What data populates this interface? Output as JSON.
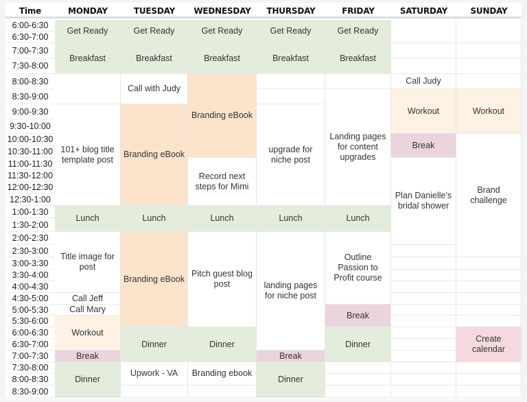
{
  "colors": {
    "green": "#e4ecdc",
    "orange": "#fbe3cc",
    "cream": "#fdf2e4",
    "mauve": "#ead4de",
    "pink": "#f6d9de",
    "white": "#ffffff"
  },
  "header": {
    "time": "Time",
    "days": [
      "MONDAY",
      "TUESDAY",
      "WEDNESDAY",
      "THURSDAY",
      "FRIDAY",
      "SATURDAY",
      "SUNDAY"
    ]
  },
  "time_slots": [
    "6:00-6:30",
    "6:30-7:00",
    "7:00-7:30",
    "7:30-8:00",
    "8:00-8:30",
    "8:30-9:00",
    "9:00-9:30",
    "9:30-10:00",
    "10:00-10:30",
    "10:30-11:00",
    "11:00-11:30",
    "11:30-12:00",
    "12:00-12:30",
    "12:30-1:00",
    "1:00-1:30",
    "1:30-2:00",
    "2:00-2:30",
    "2:30-3:00",
    "3:00-3:30",
    "3:30-4:00",
    "4:00-4:30",
    "4:30-5:00",
    "5:00-5:30",
    "5:30-6:00",
    "6:00-6:30",
    "6:30-7:00",
    "7:00-7:30",
    "7:30-8:00",
    "8:00-8:30",
    "8:30-9:00"
  ],
  "schedule": {
    "monday": [
      {
        "start": "6:00",
        "end": "7:00",
        "label": "Get Ready",
        "color": "green"
      },
      {
        "start": "7:00",
        "end": "8:00",
        "label": "Breakfast",
        "color": "green"
      },
      {
        "start": "8:00",
        "end": "9:00",
        "label": "",
        "color": "white"
      },
      {
        "start": "9:00",
        "end": "1:00",
        "label": "101+ blog title template post",
        "color": "white"
      },
      {
        "start": "1:00",
        "end": "2:00",
        "label": "Lunch",
        "color": "green"
      },
      {
        "start": "2:00",
        "end": "4:30",
        "label": "Title image for post",
        "color": "white"
      },
      {
        "start": "4:30",
        "end": "5:00",
        "label": "Call Jeff",
        "color": "white"
      },
      {
        "start": "5:00",
        "end": "5:30",
        "label": "Call Mary",
        "color": "white"
      },
      {
        "start": "5:30",
        "end": "7:00",
        "label": "Workout",
        "color": "cream"
      },
      {
        "start": "7:00",
        "end": "7:30",
        "label": "Break",
        "color": "mauve"
      },
      {
        "start": "7:30",
        "end": "9:00",
        "label": "Dinner",
        "color": "green"
      }
    ],
    "tuesday": [
      {
        "start": "6:00",
        "end": "7:00",
        "label": "Get Ready",
        "color": "green"
      },
      {
        "start": "7:00",
        "end": "8:00",
        "label": "Breakfast",
        "color": "green"
      },
      {
        "start": "8:00",
        "end": "9:00",
        "label": "Call with Judy",
        "color": "white"
      },
      {
        "start": "9:00",
        "end": "1:00",
        "label": "Branding eBook",
        "color": "orange"
      },
      {
        "start": "1:00",
        "end": "2:00",
        "label": "Lunch",
        "color": "green"
      },
      {
        "start": "2:00",
        "end": "6:00",
        "label": "Branding eBook",
        "color": "orange"
      },
      {
        "start": "6:00",
        "end": "7:30",
        "label": "Dinner",
        "color": "green"
      },
      {
        "start": "7:30",
        "end": "8:30",
        "label": "Upwork - VA",
        "color": "white"
      },
      {
        "start": "8:30",
        "end": "9:00",
        "label": "",
        "color": "white"
      }
    ],
    "wednesday": [
      {
        "start": "6:00",
        "end": "7:00",
        "label": "Get Ready",
        "color": "green"
      },
      {
        "start": "7:00",
        "end": "8:00",
        "label": "Breakfast",
        "color": "green"
      },
      {
        "start": "8:00",
        "end": "11:00",
        "label": "Branding eBook",
        "color": "orange"
      },
      {
        "start": "11:00",
        "end": "1:00",
        "label": "Record next steps for Mimi",
        "color": "white"
      },
      {
        "start": "1:00",
        "end": "2:00",
        "label": "Lunch",
        "color": "green"
      },
      {
        "start": "2:00",
        "end": "6:00",
        "label": "Pitch guest blog post",
        "color": "white"
      },
      {
        "start": "6:00",
        "end": "7:30",
        "label": "Dinner",
        "color": "green"
      },
      {
        "start": "7:30",
        "end": "8:30",
        "label": "Branding ebook",
        "color": "white"
      },
      {
        "start": "8:30",
        "end": "9:00",
        "label": "",
        "color": "white"
      }
    ],
    "thursday": [
      {
        "start": "6:00",
        "end": "7:00",
        "label": "Get Ready",
        "color": "green"
      },
      {
        "start": "7:00",
        "end": "8:00",
        "label": "Breakfast",
        "color": "green"
      },
      {
        "start": "8:00",
        "end": "8:30",
        "label": "",
        "color": "white"
      },
      {
        "start": "8:30",
        "end": "9:00",
        "label": "",
        "color": "white"
      },
      {
        "start": "9:00",
        "end": "1:00",
        "label": "upgrade for niche post",
        "color": "white"
      },
      {
        "start": "1:00",
        "end": "2:00",
        "label": "Lunch",
        "color": "green"
      },
      {
        "start": "2:00",
        "end": "7:00",
        "label": "landing pages for niche post",
        "color": "white"
      },
      {
        "start": "7:00",
        "end": "7:30",
        "label": "Break",
        "color": "mauve"
      },
      {
        "start": "7:30",
        "end": "9:00",
        "label": "Dinner",
        "color": "green"
      }
    ],
    "friday": [
      {
        "start": "6:00",
        "end": "7:00",
        "label": "Get Ready",
        "color": "green"
      },
      {
        "start": "7:00",
        "end": "8:00",
        "label": "Breakfast",
        "color": "green"
      },
      {
        "start": "8:00",
        "end": "8:30",
        "label": "",
        "color": "white"
      },
      {
        "start": "8:30",
        "end": "1:00",
        "label": "Landing pages for content upgrades",
        "color": "white"
      },
      {
        "start": "1:00",
        "end": "2:00",
        "label": "Lunch",
        "color": "green"
      },
      {
        "start": "2:00",
        "end": "5:00",
        "label": "Outline Passion to Profit course",
        "color": "white"
      },
      {
        "start": "5:00",
        "end": "6:00",
        "label": "Break",
        "color": "mauve"
      },
      {
        "start": "6:00",
        "end": "7:30",
        "label": "Dinner",
        "color": "green"
      },
      {
        "start": "7:30",
        "end": "8:00",
        "label": "",
        "color": "white"
      },
      {
        "start": "8:00",
        "end": "8:30",
        "label": "",
        "color": "white"
      },
      {
        "start": "8:30",
        "end": "9:00",
        "label": "",
        "color": "white"
      }
    ],
    "saturday": [
      {
        "start": "6:00",
        "end": "7:00",
        "label": "",
        "color": "white"
      },
      {
        "start": "7:00",
        "end": "7:30",
        "label": "",
        "color": "white"
      },
      {
        "start": "7:30",
        "end": "8:00",
        "label": "",
        "color": "white"
      },
      {
        "start": "8:00",
        "end": "8:30",
        "label": "Call Judy",
        "color": "white"
      },
      {
        "start": "8:30",
        "end": "10:00",
        "label": "Workout",
        "color": "cream"
      },
      {
        "start": "10:00",
        "end": "11:00",
        "label": "Break",
        "color": "mauve"
      },
      {
        "start": "11:00",
        "end": "2:30",
        "label": "Plan Danielle's bridal shower",
        "color": "white"
      },
      {
        "start": "2:30",
        "end": "3:00",
        "label": "",
        "color": "white"
      },
      {
        "start": "3:00",
        "end": "3:30",
        "label": "",
        "color": "white"
      },
      {
        "start": "3:30",
        "end": "4:00",
        "label": "",
        "color": "white"
      },
      {
        "start": "4:00",
        "end": "4:30",
        "label": "",
        "color": "white"
      },
      {
        "start": "4:30",
        "end": "5:00",
        "label": "",
        "color": "white"
      },
      {
        "start": "5:00",
        "end": "5:30",
        "label": "",
        "color": "white"
      },
      {
        "start": "5:30",
        "end": "6:00",
        "label": "",
        "color": "white"
      },
      {
        "start": "6:00",
        "end": "6:30",
        "label": "",
        "color": "white"
      },
      {
        "start": "6:30",
        "end": "7:00",
        "label": "",
        "color": "white"
      },
      {
        "start": "7:00",
        "end": "7:30",
        "label": "",
        "color": "white"
      },
      {
        "start": "7:30",
        "end": "8:00",
        "label": "",
        "color": "white"
      },
      {
        "start": "8:00",
        "end": "8:30",
        "label": "",
        "color": "white"
      },
      {
        "start": "8:30",
        "end": "9:00",
        "label": "",
        "color": "white"
      }
    ],
    "sunday": [
      {
        "start": "6:00",
        "end": "7:00",
        "label": "",
        "color": "white"
      },
      {
        "start": "7:00",
        "end": "7:30",
        "label": "",
        "color": "white"
      },
      {
        "start": "7:30",
        "end": "8:00",
        "label": "",
        "color": "white"
      },
      {
        "start": "8:00",
        "end": "8:30",
        "label": "",
        "color": "white"
      },
      {
        "start": "8:30",
        "end": "10:00",
        "label": "Workout",
        "color": "cream"
      },
      {
        "start": "10:00",
        "end": "3:00",
        "label": "Brand challenge",
        "color": "white"
      },
      {
        "start": "3:00",
        "end": "3:30",
        "label": "",
        "color": "white"
      },
      {
        "start": "3:30",
        "end": "4:00",
        "label": "",
        "color": "white"
      },
      {
        "start": "4:00",
        "end": "4:30",
        "label": "",
        "color": "white"
      },
      {
        "start": "4:30",
        "end": "5:00",
        "label": "",
        "color": "white"
      },
      {
        "start": "5:00",
        "end": "5:30",
        "label": "",
        "color": "white"
      },
      {
        "start": "5:30",
        "end": "6:00",
        "label": "",
        "color": "white"
      },
      {
        "start": "6:00",
        "end": "7:30",
        "label": "Create calendar",
        "color": "pink"
      },
      {
        "start": "7:30",
        "end": "8:00",
        "label": "",
        "color": "white"
      },
      {
        "start": "8:00",
        "end": "8:30",
        "label": "",
        "color": "white"
      },
      {
        "start": "8:30",
        "end": "9:00",
        "label": "",
        "color": "white"
      }
    ]
  }
}
